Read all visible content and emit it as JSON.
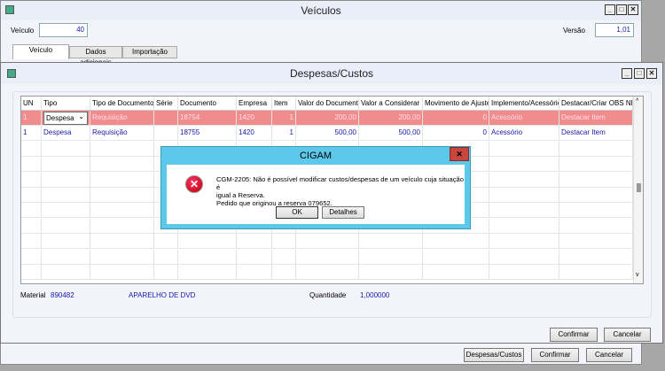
{
  "outer": {
    "title": "Veículos",
    "veiculo_label": "Veículo",
    "veiculo_value": "40",
    "versao_label": "Versão",
    "versao_value": "1,01",
    "tabs": [
      "Veículo",
      "Dados adicionais",
      "Importação"
    ],
    "buttons": {
      "despesas": "Despesas/Custos",
      "confirmar": "Confirmar",
      "cancelar": "Cancelar"
    }
  },
  "inner": {
    "title": "Despesas/Custos",
    "columns": [
      "UN",
      "Tipo",
      "Tipo de Documento",
      "Série",
      "Documento",
      "Empresa",
      "Item",
      "Valor do Documento",
      "Valor a Considerar",
      "Movimento de Ajuste",
      "Implemento/Acessório",
      "Destacar/Criar OBS NF"
    ],
    "rows": [
      [
        "1",
        "Despesa",
        "Requisição",
        "",
        "18754",
        "1420",
        "1",
        "200,00",
        "200,00",
        "0",
        "Acessório",
        "Destacar Item"
      ],
      [
        "1",
        "Despesa",
        "Requisição",
        "",
        "18755",
        "1420",
        "1",
        "500,00",
        "500,00",
        "0",
        "Acessório",
        "Destacar Item"
      ]
    ],
    "selected_row_color": "#f08c8c",
    "material_label": "Material",
    "material_code": "890482",
    "material_desc": "APARELHO DE DVD",
    "quantidade_label": "Quantidade",
    "quantidade_value": "1,000000",
    "buttons": {
      "confirmar": "Confirmar",
      "cancelar": "Cancelar"
    }
  },
  "dialog": {
    "title": "CIGAM",
    "icon": "error-icon",
    "message_line1": "CGM-2205: Não é possível modificar custos/despesas de um veículo cuja situação é",
    "message_line2": "igual a Reserva.",
    "message_line3": "Pedido que originou a reserva 079652.",
    "ok": "OK",
    "details": "Detalhes"
  }
}
